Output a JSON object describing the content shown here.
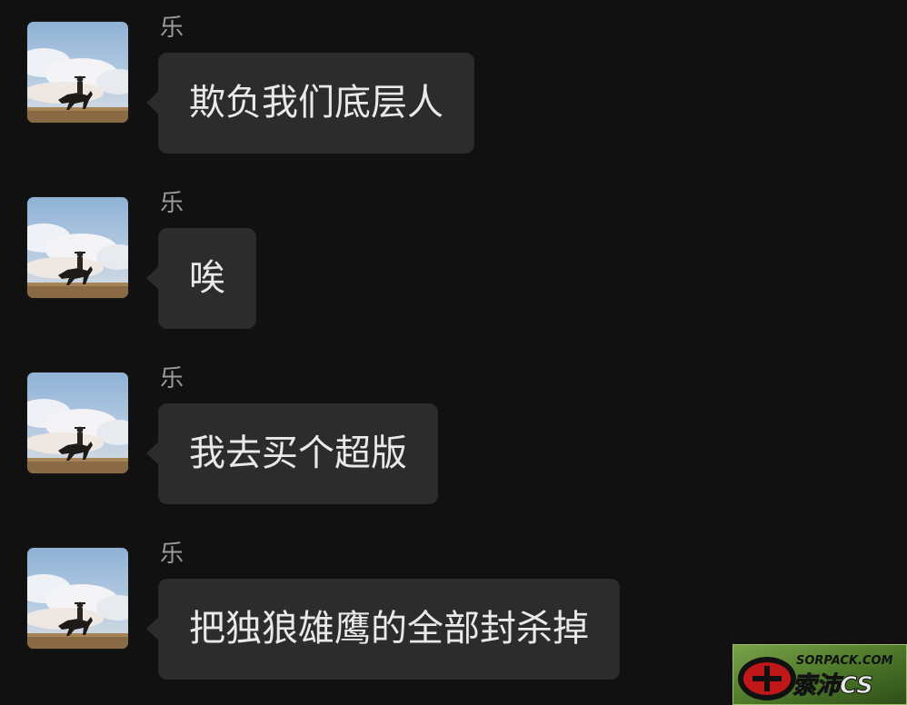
{
  "messages": [
    {
      "sender": "乐",
      "text": "欺负我们底层人"
    },
    {
      "sender": "乐",
      "text": "唉"
    },
    {
      "sender": "乐",
      "text": "我去买个超版"
    },
    {
      "sender": "乐",
      "text": "把独狼雄鹰的全部封杀掉"
    }
  ],
  "avatar": {
    "icon": "horse-rider-avatar-icon"
  },
  "watermark": {
    "site": "SORPACK.COM",
    "name": "索沛CS",
    "logo_colors": [
      "#6a9a3a",
      "#c01818",
      "#000000"
    ]
  },
  "colors": {
    "background": "#121112",
    "bubble": "#2c2c2c",
    "bubble_text": "#e9e9e9",
    "sender_text": "#9c9c9c"
  }
}
